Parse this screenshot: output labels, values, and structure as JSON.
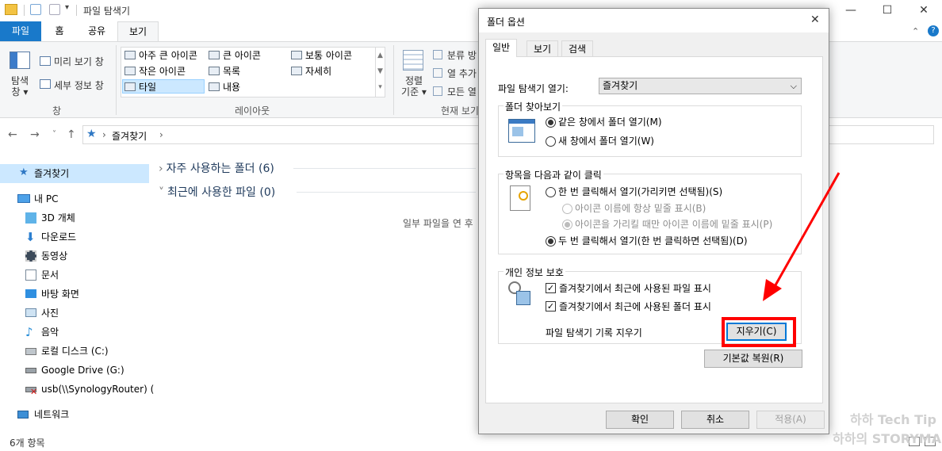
{
  "explorer": {
    "title": "파일 탐색기",
    "tabs": [
      "파일",
      "홈",
      "공유",
      "보기"
    ],
    "ribbon": {
      "nav_pane": "탐색\n창",
      "nav_pane_line1": "탐색",
      "nav_pane_line2": "창 ▾",
      "preview_pane": "미리 보기 창",
      "details_pane": "세부 정보 창",
      "panes_group": "창",
      "layout_items": [
        "아주 큰 아이콘",
        "큰 아이콘",
        "보통 아이콘",
        "작은 아이콘",
        "목록",
        "자세히",
        "타일",
        "내용"
      ],
      "layout_group": "레이아웃",
      "sort_by_line1": "정렬",
      "sort_by_line2": "기준 ▾",
      "group_by": "분류 방",
      "add_col": "열 추가",
      "fit_cols": "모든 열",
      "current_view_group": "현재 보기"
    },
    "address": {
      "location": "즐겨찾기"
    },
    "sidebar": {
      "items": [
        "즐겨찾기",
        "내 PC",
        "3D 개체",
        "다운로드",
        "동영상",
        "문서",
        "바탕 화면",
        "사진",
        "음악",
        "로컬 디스크 (C:)",
        "Google Drive (G:)",
        "usb(\\\\SynologyRouter) (",
        "네트워크"
      ]
    },
    "content": {
      "frequent_folders": "자주 사용하는 폴더 (6)",
      "recent_files": "최근에 사용한 파일 (0)",
      "empty_message": "일부 파일을 연 후"
    },
    "status": "6개 항목"
  },
  "dialog": {
    "title": "폴더 옵션",
    "tabs": [
      "일반",
      "보기",
      "검색"
    ],
    "open_explorer_label": "파일 탐색기 열기:",
    "open_explorer_value": "즐겨찾기",
    "browse_group": "폴더 찾아보기",
    "browse_same": "같은 창에서 폴더 열기(M)",
    "browse_new": "새 창에서 폴더 열기(W)",
    "click_group": "항목을 다음과 같이 클릭",
    "single_click": "한 번 클릭해서 열기(가리키면 선택됨)(S)",
    "underline_always": "아이콘 이름에 항상 밑줄 표시(B)",
    "underline_hover": "아이콘을 가리킬 때만 아이콘 이름에 밑줄 표시(P)",
    "double_click": "두 번 클릭해서 열기(한 번 클릭하면 선택됨)(D)",
    "privacy_group": "개인 정보 보호",
    "show_recent_files": "즐겨찾기에서 최근에 사용된 파일 표시",
    "show_frequent_folders": "즐겨찾기에서 최근에 사용된 폴더 표시",
    "clear_history_label": "파일 탐색기 기록 지우기",
    "clear_button": "지우기(C)",
    "restore_defaults": "기본값 복원(R)",
    "ok": "확인",
    "cancel": "취소",
    "apply": "적용(A)"
  },
  "watermark": {
    "line1": "하하 Tech Tip",
    "line2": "하하의 STORYMAN"
  },
  "colors": {
    "file_tab": "#1979ca",
    "highlight": "#ff0000",
    "selection": "#cce8ff"
  }
}
